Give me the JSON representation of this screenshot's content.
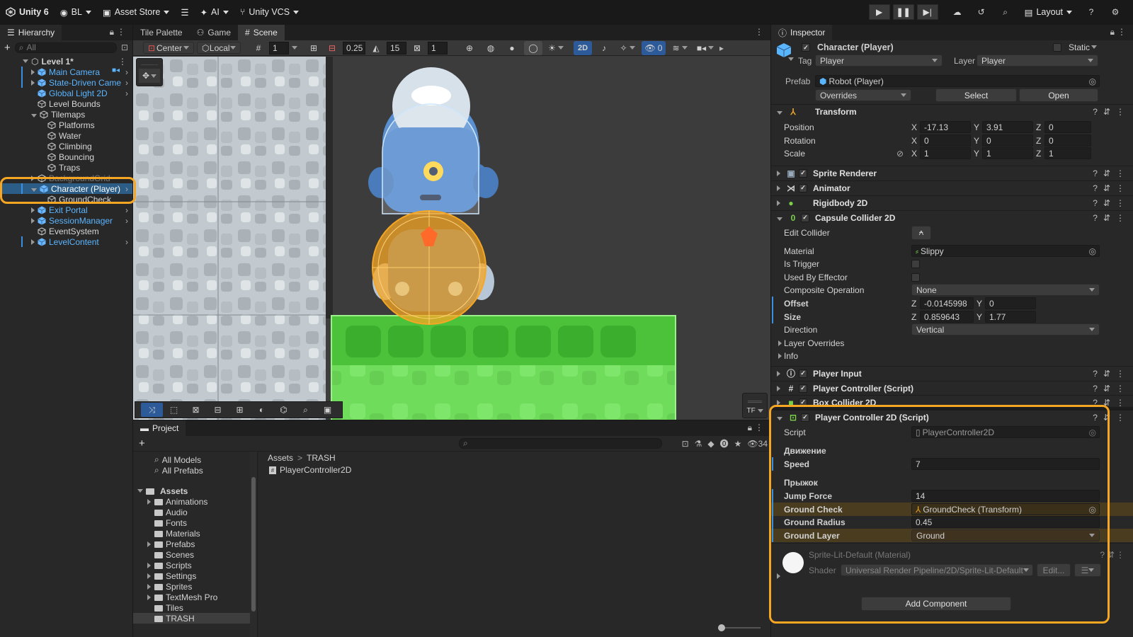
{
  "topbar": {
    "app": "Unity 6",
    "account": "BL",
    "asset_store": "Asset Store",
    "ai": "AI",
    "vcs": "Unity VCS",
    "layout": "Layout"
  },
  "hierarchy": {
    "tab": "Hierarchy",
    "search_placeholder": "All",
    "scene": "Level 1*",
    "items": [
      {
        "label": "Main Camera",
        "blue": true
      },
      {
        "label": "State-Driven Came",
        "blue": true
      },
      {
        "label": "Global Light 2D",
        "blue": true
      },
      {
        "label": "Level Bounds",
        "blue": false
      },
      {
        "label": "Tilemaps",
        "blue": false
      },
      {
        "label": "Platforms",
        "blue": false
      },
      {
        "label": "Water",
        "blue": false
      },
      {
        "label": "Climbing",
        "blue": false
      },
      {
        "label": "Bouncing",
        "blue": false
      },
      {
        "label": "Traps",
        "blue": false
      },
      {
        "label": "BackgroundGrid",
        "blue": false
      },
      {
        "label": "Character (Player)",
        "blue": true
      },
      {
        "label": "GroundCheck",
        "blue": false
      },
      {
        "label": "Exit Portal",
        "blue": true
      },
      {
        "label": "SessionManager",
        "blue": true
      },
      {
        "label": "EventSystem",
        "blue": false
      },
      {
        "label": "LevelContent",
        "blue": true
      }
    ]
  },
  "scene_view": {
    "tabs": [
      "Tile Palette",
      "Game",
      "Scene"
    ],
    "pivot": "Center",
    "space": "Local",
    "grid_value": "1",
    "snap_value": "0.25",
    "angle_value": "15",
    "scale_value": "1",
    "mode_2d": "2D",
    "hidden_count": "0",
    "overlay_label": "TF"
  },
  "project": {
    "tab": "Project",
    "count": "34",
    "favorites": [
      "All Models",
      "All Prefabs"
    ],
    "assets_root": "Assets",
    "folders": [
      "Animations",
      "Audio",
      "Fonts",
      "Materials",
      "Prefabs",
      "Scenes",
      "Scripts",
      "Settings",
      "Sprites",
      "TextMesh Pro",
      "Tiles",
      "TRASH"
    ],
    "breadcrumb": [
      "Assets",
      "TRASH"
    ],
    "files": [
      "PlayerController2D"
    ]
  },
  "inspector": {
    "tab": "Inspector",
    "object_name": "Character (Player)",
    "static_label": "Static",
    "tag_label": "Tag",
    "tag_value": "Player",
    "layer_label": "Layer",
    "layer_value": "Player",
    "prefab_label": "Prefab",
    "prefab_value": "Robot (Player)",
    "overrides": "Overrides",
    "select": "Select",
    "open": "Open",
    "transform": {
      "title": "Transform",
      "position_label": "Position",
      "position": [
        "-17.13",
        "3.91",
        "0"
      ],
      "rotation_label": "Rotation",
      "rotation": [
        "0",
        "0",
        "0"
      ],
      "scale_label": "Scale",
      "scale": [
        "1",
        "1",
        "1"
      ],
      "axis": [
        "X",
        "Y",
        "Z"
      ]
    },
    "components_top": [
      "Sprite Renderer",
      "Animator",
      "Rigidbody 2D"
    ],
    "capsule": {
      "title": "Capsule Collider 2D",
      "edit_collider": "Edit Collider",
      "material_label": "Material",
      "material": "Slippy",
      "is_trigger": "Is Trigger",
      "used_by_effector": "Used By Effector",
      "composite_label": "Composite Operation",
      "composite": "None",
      "offset_label": "Offset",
      "offset": [
        "-0.0145998",
        "0"
      ],
      "size_label": "Size",
      "size": [
        "0.859643",
        "1.77"
      ],
      "direction_label": "Direction",
      "direction": "Vertical",
      "layer_overrides": "Layer Overrides",
      "info": "Info",
      "z_axis": "Z",
      "y_axis": "Y"
    },
    "components_mid": [
      "Player Input",
      "Player Controller (Script)",
      "Box Collider 2D"
    ],
    "pc2d": {
      "title": "Player Controller 2D (Script)",
      "script_label": "Script",
      "script": "PlayerController2D",
      "header_move": "Движение",
      "speed_label": "Speed",
      "speed": "7",
      "header_jump": "Прыжок",
      "jump_label": "Jump Force",
      "jump": "14",
      "ground_check_label": "Ground Check",
      "ground_check": "GroundCheck (Transform)",
      "ground_radius_label": "Ground Radius",
      "ground_radius": "0.45",
      "ground_layer_label": "Ground Layer",
      "ground_layer": "Ground"
    },
    "material": {
      "name": "Sprite-Lit-Default (Material)",
      "shader_label": "Shader",
      "shader": "Universal Render Pipeline/2D/Sprite-Lit-Default",
      "edit": "Edit..."
    },
    "add_component": "Add Component"
  },
  "colors": {
    "highlight": "#f5a623",
    "accent_blue": "#5ab5ff",
    "collider": "#6ee05a"
  }
}
